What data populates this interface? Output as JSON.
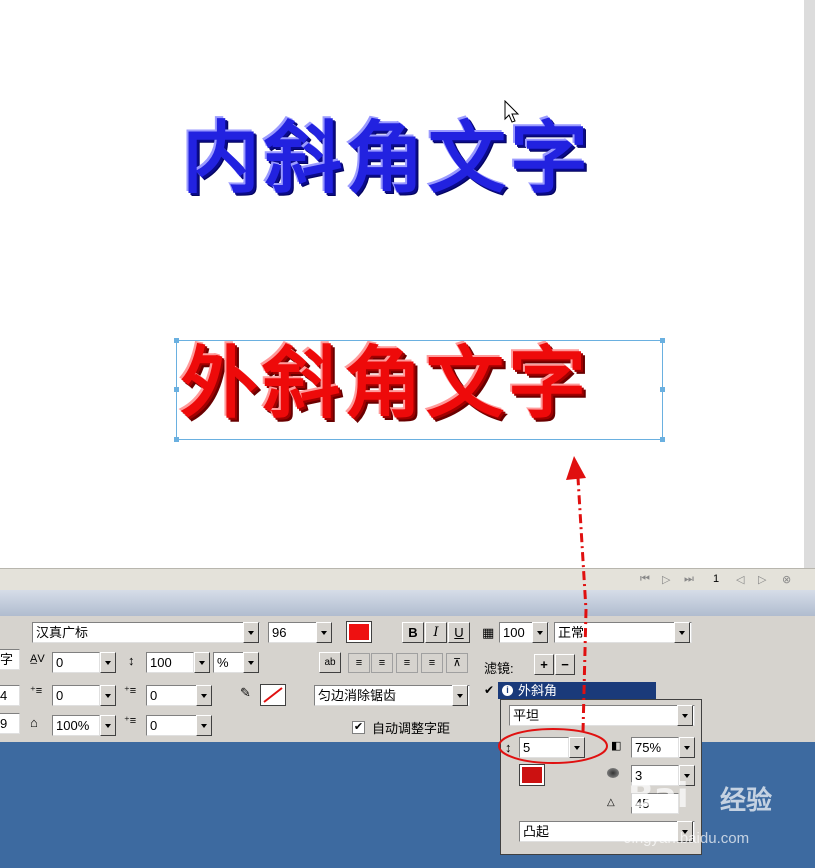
{
  "canvas": {
    "text_inner": "内斜角文字",
    "text_outer": "外斜角文字"
  },
  "timeline": {
    "frame_number": "1"
  },
  "properties": {
    "partial_label_1": "字",
    "partial_value_1": "4",
    "partial_value_2": "9",
    "font_family": "汉真广标",
    "font_size": "96",
    "letter_spacing": "0",
    "line_height": "100",
    "line_height_unit": "%",
    "indent": "0",
    "left_margin": "0",
    "right_margin": "0",
    "first_line": "0",
    "scale": "100%",
    "bold_label": "B",
    "italic_label": "I",
    "underline_label": "U",
    "antialias": "匀边消除锯齿",
    "auto_kern_label": "自动调整字距",
    "auto_kern_checked": true,
    "text_color": "#ee1111",
    "opacity": "100",
    "blend_mode": "正常",
    "filters_label": "滤镜:",
    "add_label": "+",
    "remove_label": "−"
  },
  "filters": {
    "selected_item": "外斜角",
    "bevel_style": "平坦",
    "width": "5",
    "opacity": "75%",
    "softness": "3",
    "angle": "45",
    "bevel_color": "#cc1111",
    "emboss": "凸起"
  },
  "watermark": {
    "site": "Jingyan.baidu.com",
    "brand": "经验"
  },
  "colors": {
    "annotation": "#e01010",
    "selected_bg": "#1a3a7a",
    "panel_bg": "#d6d3ce"
  }
}
